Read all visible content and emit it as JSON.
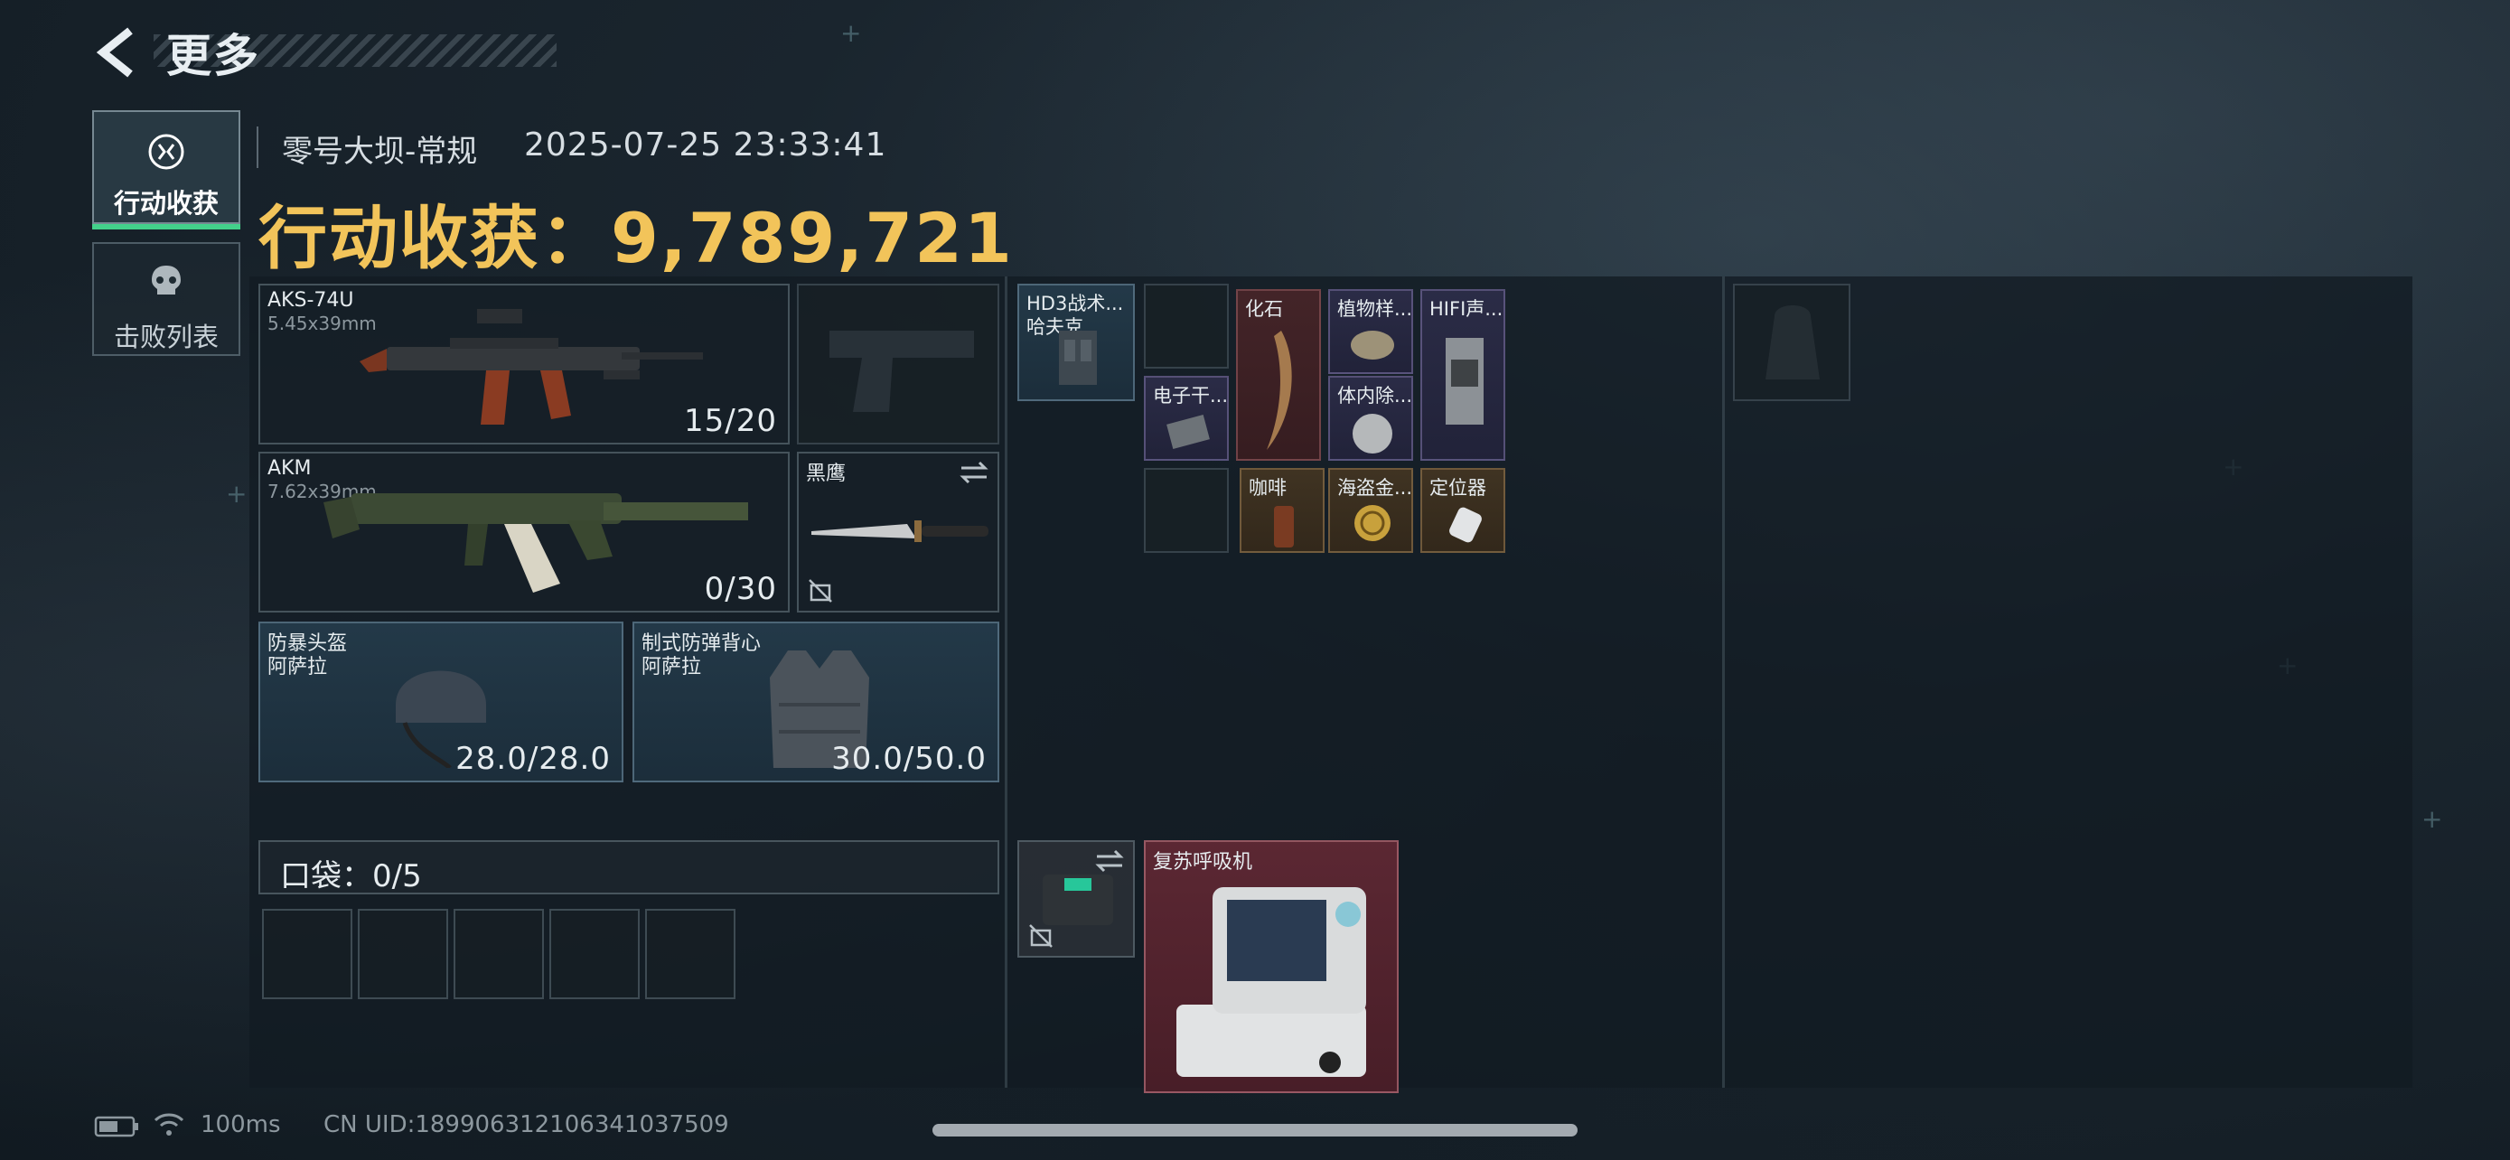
{
  "header": {
    "title": "更多"
  },
  "tabs": [
    {
      "label": "行动收获",
      "active": true,
      "icon": "loot-icon"
    },
    {
      "label": "击败列表",
      "active": false,
      "icon": "skull-icon"
    }
  ],
  "info": {
    "map_name": "零号大坝-常规",
    "datetime": "2025-07-25 23:33:41",
    "loot_title": "行动收获：9,789,721"
  },
  "weapons": [
    {
      "name": "AKS-74U",
      "caliber": "5.45x39mm",
      "ammo": "15/20"
    },
    {
      "name": "AKM",
      "caliber": "7.62x39mm",
      "ammo": "0/30"
    }
  ],
  "secondary": {
    "melee_name": "黑鹰"
  },
  "armor": [
    {
      "name": "防暴头盔",
      "sub": "阿萨拉",
      "durability": "28.0/28.0"
    },
    {
      "name": "制式防弹背心",
      "sub": "阿萨拉",
      "durability": "30.0/50.0"
    }
  ],
  "pocket": {
    "label": "口袋：0/5"
  },
  "chest_rig": {
    "name": "HD3战术...",
    "sub": "哈夫克"
  },
  "items": [
    {
      "name": "电子干..."
    },
    {
      "name": "化石"
    },
    {
      "name": "植物样..."
    },
    {
      "name": "体内除..."
    },
    {
      "name": "HIFI声..."
    },
    {
      "name": "咖啡"
    },
    {
      "name": "海盗金..."
    },
    {
      "name": "定位器"
    }
  ],
  "case_item": {
    "name": "复苏呼吸机"
  },
  "footer": {
    "ping": "100ms",
    "uid": "CN UID:189906312106341037509"
  },
  "colors": {
    "accent": "#43d18b",
    "gold": "#f2c45a"
  }
}
